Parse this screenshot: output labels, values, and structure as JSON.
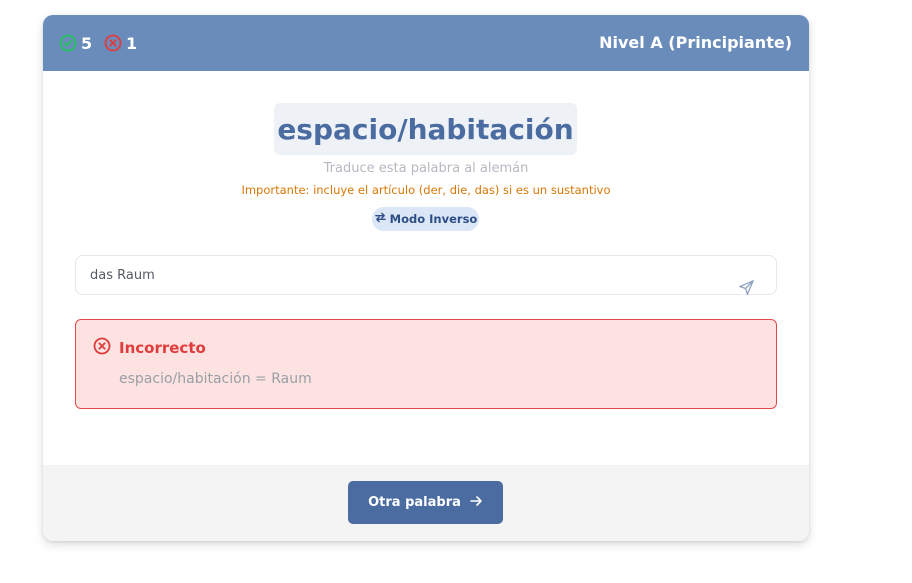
{
  "header": {
    "correct_count": "5",
    "wrong_count": "1",
    "level": "Nivel A (Principiante)"
  },
  "quiz": {
    "word": "espacio/habitación",
    "instruction": "Traduce esta palabra al alemán",
    "note": "Importante: incluye el artículo (der, die, das) si es un sustantivo",
    "mode_label": "Modo Inverso"
  },
  "answer": {
    "value": "das Raum",
    "placeholder": ""
  },
  "feedback": {
    "title": "Incorrecto",
    "correct_answer": "espacio/habitación = Raum"
  },
  "footer": {
    "next_label": "Otra palabra"
  },
  "icons": {
    "correct": "check-circle-icon",
    "wrong": "x-circle-icon",
    "swap": "swap-arrows-icon",
    "send": "send-icon",
    "arrow": "arrow-right-icon"
  },
  "colors": {
    "header": "#6a8cba",
    "primary": "#4a6ca1",
    "correct": "#22c55e",
    "error": "#e03c3c",
    "note": "#d97706",
    "feedback_bg": "#fde2e2"
  }
}
